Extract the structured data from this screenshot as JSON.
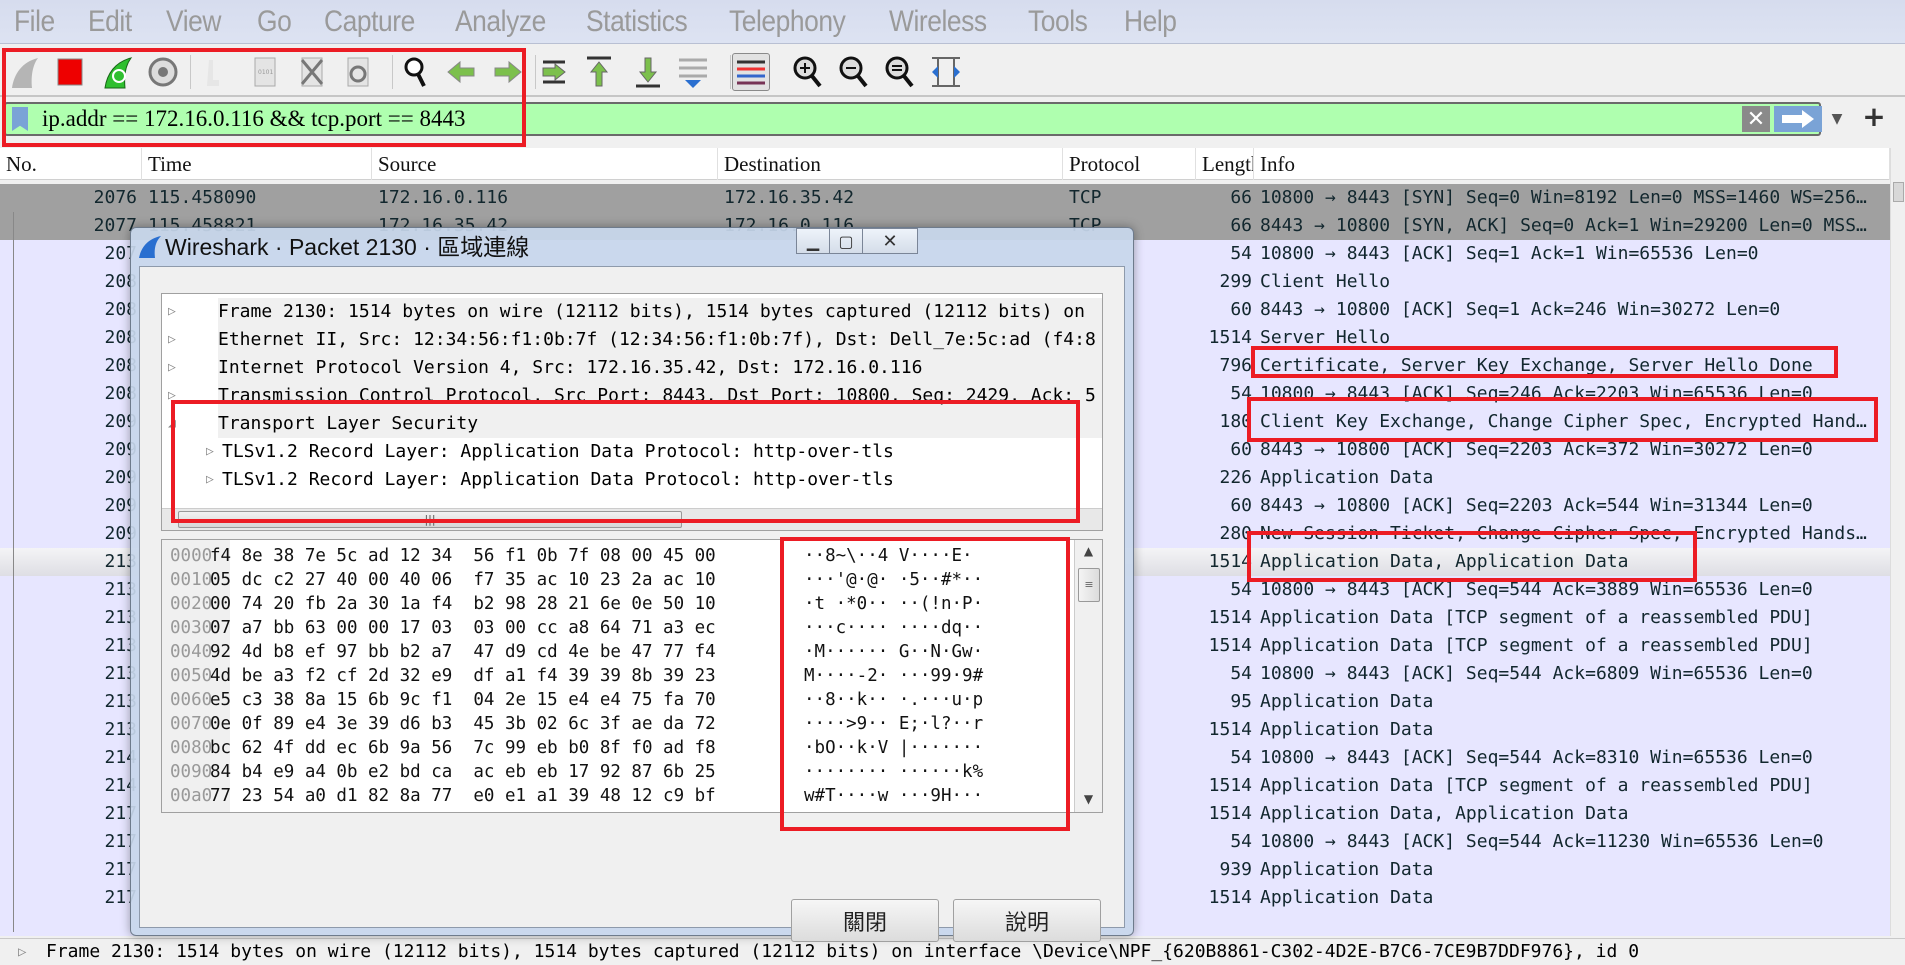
{
  "menu": [
    "File",
    "Edit",
    "View",
    "Go",
    "Capture",
    "Analyze",
    "Statistics",
    "Telephony",
    "Wireless",
    "Tools",
    "Help"
  ],
  "toolbar": {
    "icons": [
      "start-capture-icon",
      "stop-capture-icon",
      "restart-capture-icon",
      "capture-options-icon",
      "open-file-icon",
      "save-file-icon",
      "close-file-icon",
      "reload-file-icon",
      "find-packet-icon",
      "go-back-icon",
      "go-forward-icon",
      "go-to-packet-icon",
      "first-packet-icon",
      "last-packet-icon",
      "autoscroll-icon",
      "colorize-icon",
      "zoom-in-icon",
      "zoom-out-icon",
      "normal-size-icon",
      "resize-columns-icon"
    ],
    "pressed": "colorize-icon"
  },
  "filter": {
    "value": "ip.addr == 172.16.0.116 && tcp.port == 8443"
  },
  "colors": {
    "filter_valid": "#afffaf",
    "tcp_syn_row": "#a0a0a0",
    "tls_row": "#e7e6ff",
    "highlight_box": "#ec1c24",
    "apply_button": "#7aa3d6"
  },
  "columns": [
    "No.",
    "Time",
    "Source",
    "Destination",
    "Protocol",
    "Length",
    "Info"
  ],
  "packets": [
    {
      "no": "2076",
      "time": "115.458090",
      "src": "172.16.0.116",
      "dst": "172.16.35.42",
      "proto": "TCP",
      "len": "66",
      "info": "10800 → 8443 [SYN] Seq=0 Win=8192 Len=0 MSS=1460 WS=256…",
      "style": "syn"
    },
    {
      "no": "2077",
      "time": "115.458821",
      "src": "172.16.35.42",
      "dst": "172.16.0.116",
      "proto": "TCP",
      "len": "66",
      "info": "8443 → 10800 [SYN, ACK] Seq=0 Ack=1 Win=29200 Len=0 MSS…",
      "style": "syn"
    },
    {
      "no": "207",
      "proto": "",
      "len": "54",
      "info": "10800 → 8443 [ACK] Seq=1 Ack=1 Win=65536 Len=0"
    },
    {
      "no": "208",
      "proto": "2",
      "len": "299",
      "info": "Client Hello"
    },
    {
      "no": "208",
      "proto": "",
      "len": "60",
      "info": "8443 → 10800 [ACK] Seq=1 Ack=246 Win=30272 Len=0"
    },
    {
      "no": "208",
      "proto": "2",
      "len": "1514",
      "info": "Server Hello"
    },
    {
      "no": "208",
      "proto": "2",
      "len": "796",
      "info": "Certificate, Server Key Exchange, Server Hello Done"
    },
    {
      "no": "208",
      "proto": "",
      "len": "54",
      "info": "10800 → 8443 [ACK] Seq=246 Ack=2203 Win=65536 Len=0"
    },
    {
      "no": "209",
      "proto": "2",
      "len": "180",
      "info": "Client Key Exchange, Change Cipher Spec, Encrypted Hand…"
    },
    {
      "no": "209",
      "proto": "",
      "len": "60",
      "info": "8443 → 10800 [ACK] Seq=2203 Ack=372 Win=30272 Len=0"
    },
    {
      "no": "209",
      "proto": "2",
      "len": "226",
      "info": "Application Data"
    },
    {
      "no": "209",
      "proto": "",
      "len": "60",
      "info": "8443 → 10800 [ACK] Seq=2203 Ack=544 Win=31344 Len=0"
    },
    {
      "no": "209",
      "proto": "2",
      "len": "280",
      "info": "New Session Ticket, Change Cipher Spec, Encrypted Hands…"
    },
    {
      "no": "213",
      "proto": "2",
      "len": "1514",
      "info": "Application Data, Application Data",
      "style": "sel"
    },
    {
      "no": "213",
      "proto": "",
      "len": "54",
      "info": "10800 → 8443 [ACK] Seq=544 Ack=3889 Win=65536 Len=0"
    },
    {
      "no": "213",
      "proto": "2",
      "len": "1514",
      "info": "Application Data [TCP segment of a reassembled PDU]"
    },
    {
      "no": "213",
      "proto": "2",
      "len": "1514",
      "info": "Application Data [TCP segment of a reassembled PDU]"
    },
    {
      "no": "213",
      "proto": "",
      "len": "54",
      "info": "10800 → 8443 [ACK] Seq=544 Ack=6809 Win=65536 Len=0"
    },
    {
      "no": "213",
      "proto": "2",
      "len": "95",
      "info": "Application Data"
    },
    {
      "no": "213",
      "proto": "2",
      "len": "1514",
      "info": "Application Data"
    },
    {
      "no": "214",
      "proto": "",
      "len": "54",
      "info": "10800 → 8443 [ACK] Seq=544 Ack=8310 Win=65536 Len=0"
    },
    {
      "no": "214",
      "proto": "2",
      "len": "1514",
      "info": "Application Data [TCP segment of a reassembled PDU]"
    },
    {
      "no": "217",
      "proto": "2",
      "len": "1514",
      "info": "Application Data, Application Data"
    },
    {
      "no": "217",
      "proto": "",
      "len": "54",
      "info": "10800 → 8443 [ACK] Seq=544 Ack=11230 Win=65536 Len=0"
    },
    {
      "no": "217",
      "proto": "2",
      "len": "939",
      "info": "Application Data"
    },
    {
      "no": "217",
      "proto": "2",
      "len": "1514",
      "info": "Application Data"
    }
  ],
  "status": "Frame 2130: 1514 bytes on wire (12112 bits), 1514 bytes captured (12112 bits) on interface \\Device\\NPF_{620B8861-C302-4D2E-B7C6-7CE9B7DDF976}, id 0",
  "dialog": {
    "title": "Wireshark · Packet 2130 · 區域連線",
    "tree": [
      {
        "text": "Frame 2130: 1514 bytes on wire (12112 bits), 1514 bytes captured (12112 bits) on",
        "expanded": false,
        "level": 0
      },
      {
        "text": "Ethernet II, Src: 12:34:56:f1:0b:7f (12:34:56:f1:0b:7f), Dst: Dell_7e:5c:ad (f4:8",
        "expanded": false,
        "level": 0
      },
      {
        "text": "Internet Protocol Version 4, Src: 172.16.35.42, Dst: 172.16.0.116",
        "expanded": false,
        "level": 0
      },
      {
        "text": "Transmission Control Protocol, Src Port: 8443, Dst Port: 10800, Seq: 2429, Ack: 5",
        "expanded": false,
        "level": 0
      },
      {
        "text": "Transport Layer Security",
        "expanded": true,
        "level": 0
      },
      {
        "text": "TLSv1.2 Record Layer: Application Data Protocol: http-over-tls",
        "expanded": false,
        "level": 1
      },
      {
        "text": "TLSv1.2 Record Layer: Application Data Protocol: http-over-tls",
        "expanded": false,
        "level": 1
      }
    ],
    "hex": [
      {
        "off": "0000",
        "hex": "f4 8e 38 7e 5c ad 12 34  56 f1 0b 7f 08 00 45 00",
        "ascii": "··8~\\··4 V····E·"
      },
      {
        "off": "0010",
        "hex": "05 dc c2 27 40 00 40 06  f7 35 ac 10 23 2a ac 10",
        "ascii": "···'@·@· ·5··#*··"
      },
      {
        "off": "0020",
        "hex": "00 74 20 fb 2a 30 1a f4  b2 98 28 21 6e 0e 50 10",
        "ascii": "·t ·*0·· ··(!n·P·"
      },
      {
        "off": "0030",
        "hex": "07 a7 bb 63 00 00 17 03  03 00 cc a8 64 71 a3 ec",
        "ascii": "···c···· ····dq··"
      },
      {
        "off": "0040",
        "hex": "92 4d b8 ef 97 bb b2 a7  47 d9 cd 4e be 47 77 f4",
        "ascii": "·M······ G··N·Gw·"
      },
      {
        "off": "0050",
        "hex": "4d be a3 f2 cf 2d 32 e9  df a1 f4 39 39 8b 39 23",
        "ascii": "M····-2· ···99·9#"
      },
      {
        "off": "0060",
        "hex": "e5 c3 38 8a 15 6b 9c f1  04 2e 15 e4 e4 75 fa 70",
        "ascii": "··8··k·· ·.···u·p"
      },
      {
        "off": "0070",
        "hex": "0e 0f 89 e4 3e 39 d6 b3  45 3b 02 6c 3f ae da 72",
        "ascii": "····>9·· E;·l?··r"
      },
      {
        "off": "0080",
        "hex": "bc 62 4f dd ec 6b 9a 56  7c 99 eb b0 8f f0 ad f8",
        "ascii": "·bO··k·V |·······"
      },
      {
        "off": "0090",
        "hex": "84 b4 e9 a4 0b e2 bd ca  ac eb eb 17 92 87 6b 25",
        "ascii": "········ ······k%"
      },
      {
        "off": "00a0",
        "hex": "77 23 54 a0 d1 82 8a 77  e0 e1 a1 39 48 12 c9 bf",
        "ascii": "w#T····w ···9H···"
      }
    ],
    "close_label": "關閉",
    "help_label": "說明"
  }
}
